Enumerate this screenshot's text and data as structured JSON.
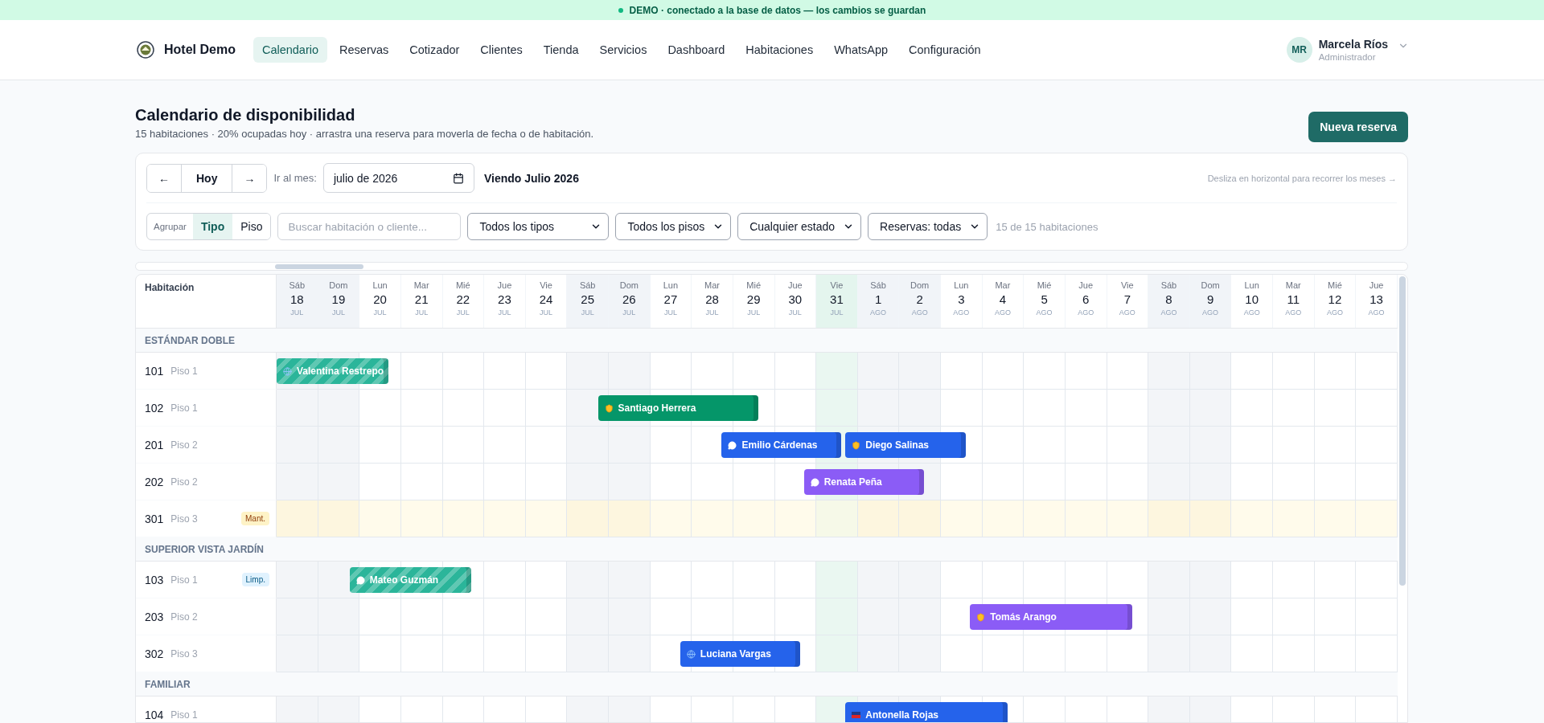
{
  "banner": {
    "text": "DEMO · conectado a la base de datos — los cambios se guardan"
  },
  "nav": {
    "brand": "Hotel Demo",
    "items": [
      {
        "label": "Calendario",
        "selected": true
      },
      {
        "label": "Reservas",
        "selected": false
      },
      {
        "label": "Cotizador",
        "selected": false
      },
      {
        "label": "Clientes",
        "selected": false
      },
      {
        "label": "Tienda",
        "selected": false
      },
      {
        "label": "Servicios",
        "selected": false
      },
      {
        "label": "Dashboard",
        "selected": false
      },
      {
        "label": "Habitaciones",
        "selected": false
      },
      {
        "label": "WhatsApp",
        "selected": false
      },
      {
        "label": "Configuración",
        "selected": false
      }
    ],
    "user": {
      "initials": "MR",
      "name": "Marcela Ríos",
      "role": "Administrador"
    }
  },
  "header": {
    "title": "Calendario de disponibilidad",
    "subtitle": "15 habitaciones · 20% ocupadas hoy · arrastra una reserva para moverla de fecha o de habitación.",
    "action": "Nueva reserva"
  },
  "toolbar": {
    "prev": "←",
    "today": "Hoy",
    "next": "→",
    "month_label": "Ir al mes:",
    "month_value": "julio de 2026",
    "viewing": "Viendo Julio 2026",
    "hint": "Desliza en horizontal para recorrer los meses →"
  },
  "filters": {
    "group_label": "Agrupar",
    "group_options": [
      {
        "label": "Tipo",
        "selected": true
      },
      {
        "label": "Piso",
        "selected": false
      }
    ],
    "search_placeholder": "Buscar habitación o cliente...",
    "selects": [
      "Todos los tipos",
      "Todos los pisos",
      "Cualquier estado",
      "Reservas: todas"
    ],
    "count": "15 de 15 habitaciones"
  },
  "grid": {
    "room_heading": "Habitación",
    "days": [
      {
        "weekday": "Sáb",
        "day": "18",
        "month": "JUL",
        "weekend": true,
        "today": false
      },
      {
        "weekday": "Dom",
        "day": "19",
        "month": "JUL",
        "weekend": true,
        "today": false
      },
      {
        "weekday": "Lun",
        "day": "20",
        "month": "JUL",
        "weekend": false,
        "today": false
      },
      {
        "weekday": "Mar",
        "day": "21",
        "month": "JUL",
        "weekend": false,
        "today": false
      },
      {
        "weekday": "Mié",
        "day": "22",
        "month": "JUL",
        "weekend": false,
        "today": false
      },
      {
        "weekday": "Jue",
        "day": "23",
        "month": "JUL",
        "weekend": false,
        "today": false
      },
      {
        "weekday": "Vie",
        "day": "24",
        "month": "JUL",
        "weekend": false,
        "today": false
      },
      {
        "weekday": "Sáb",
        "day": "25",
        "month": "JUL",
        "weekend": true,
        "today": false
      },
      {
        "weekday": "Dom",
        "day": "26",
        "month": "JUL",
        "weekend": true,
        "today": false
      },
      {
        "weekday": "Lun",
        "day": "27",
        "month": "JUL",
        "weekend": false,
        "today": false
      },
      {
        "weekday": "Mar",
        "day": "28",
        "month": "JUL",
        "weekend": false,
        "today": false
      },
      {
        "weekday": "Mié",
        "day": "29",
        "month": "JUL",
        "weekend": false,
        "today": false
      },
      {
        "weekday": "Jue",
        "day": "30",
        "month": "JUL",
        "weekend": false,
        "today": false
      },
      {
        "weekday": "Vie",
        "day": "31",
        "month": "JUL",
        "weekend": false,
        "today": true
      },
      {
        "weekday": "Sáb",
        "day": "1",
        "month": "AGO",
        "weekend": true,
        "today": false
      },
      {
        "weekday": "Dom",
        "day": "2",
        "month": "AGO",
        "weekend": true,
        "today": false
      },
      {
        "weekday": "Lun",
        "day": "3",
        "month": "AGO",
        "weekend": false,
        "today": false
      },
      {
        "weekday": "Mar",
        "day": "4",
        "month": "AGO",
        "weekend": false,
        "today": false
      },
      {
        "weekday": "Mié",
        "day": "5",
        "month": "AGO",
        "weekend": false,
        "today": false
      },
      {
        "weekday": "Jue",
        "day": "6",
        "month": "AGO",
        "weekend": false,
        "today": false
      },
      {
        "weekday": "Vie",
        "day": "7",
        "month": "AGO",
        "weekend": false,
        "today": false
      },
      {
        "weekday": "Sáb",
        "day": "8",
        "month": "AGO",
        "weekend": true,
        "today": false
      },
      {
        "weekday": "Dom",
        "day": "9",
        "month": "AGO",
        "weekend": true,
        "today": false
      },
      {
        "weekday": "Lun",
        "day": "10",
        "month": "AGO",
        "weekend": false,
        "today": false
      },
      {
        "weekday": "Mar",
        "day": "11",
        "month": "AGO",
        "weekend": false,
        "today": false
      },
      {
        "weekday": "Mié",
        "day": "12",
        "month": "AGO",
        "weekend": false,
        "today": false
      },
      {
        "weekday": "Jue",
        "day": "13",
        "month": "AGO",
        "weekend": false,
        "today": false
      }
    ],
    "groups": [
      {
        "name": "ESTÁNDAR DOBLE",
        "rooms": [
          {
            "number": "101",
            "floor": "Piso 1",
            "kind": "available",
            "bookings": [
              {
                "guest": "Valentina Restrepo",
                "color": "#2bb59a",
                "striped": true,
                "kind": "web"
              }
            ]
          },
          {
            "number": "102",
            "floor": "Piso 1",
            "kind": "available",
            "bookings": [
              {
                "guest": "Santiago Herrera",
                "color": "#059669",
                "striped": false,
                "kind": "shield"
              }
            ]
          },
          {
            "number": "201",
            "floor": "Piso 2",
            "kind": "available",
            "bookings": [
              {
                "guest": "Emilio Cárdenas",
                "color": "#2563eb",
                "striped": false,
                "kind": "chat"
              },
              {
                "guest": "Diego Salinas",
                "color": "#2563eb",
                "striped": false,
                "kind": "shield"
              }
            ]
          },
          {
            "number": "202",
            "floor": "Piso 2",
            "kind": "available",
            "bookings": [
              {
                "guest": "Renata Peña",
                "color": "#8b5cf6",
                "striped": false,
                "kind": "chat"
              }
            ]
          },
          {
            "number": "301",
            "floor": "Piso 3",
            "kind": "maintenance",
            "badge": "Mant."
          }
        ]
      },
      {
        "name": "SUPERIOR VISTA JARDÍN",
        "rooms": [
          {
            "number": "103",
            "floor": "Piso 1",
            "kind": "cleaning",
            "badge": "Limp.",
            "bookings": [
              {
                "guest": "Mateo Guzmán",
                "color": "#2bb59a",
                "striped": true,
                "kind": "chat"
              }
            ]
          },
          {
            "number": "203",
            "floor": "Piso 2",
            "kind": "available",
            "bookings": [
              {
                "guest": "Tomás Arango",
                "color": "#8b5cf6",
                "striped": false,
                "kind": "shield"
              }
            ]
          },
          {
            "number": "302",
            "floor": "Piso 3",
            "kind": "available",
            "bookings": [
              {
                "guest": "Luciana Vargas",
                "color": "#2563eb",
                "striped": false,
                "kind": "web"
              }
            ]
          }
        ]
      },
      {
        "name": "FAMILIAR",
        "rooms": [
          {
            "number": "104",
            "floor": "Piso 1",
            "kind": "available",
            "bookings": [
              {
                "guest": "Antonella Rojas",
                "color": "#2563eb",
                "striped": false,
                "kind": "flag"
              }
            ]
          }
        ]
      }
    ]
  }
}
